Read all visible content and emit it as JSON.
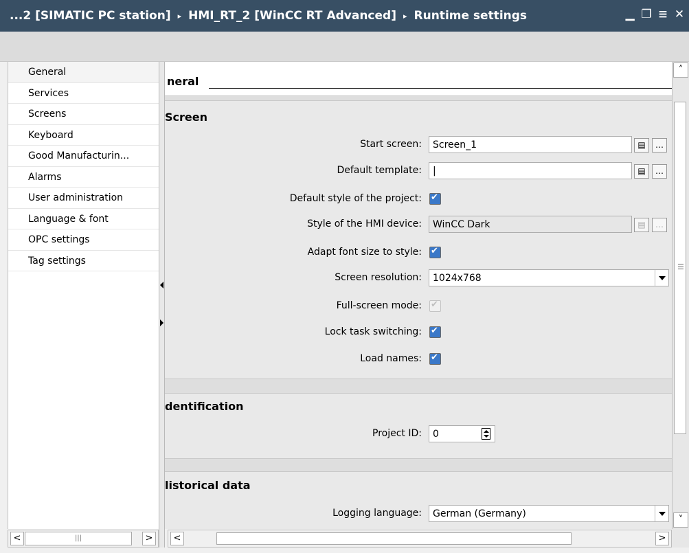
{
  "titlebar": {
    "crumbs": [
      "...2 [SIMATIC PC station]",
      "HMI_RT_2 [WinCC RT Advanced]",
      "Runtime settings"
    ],
    "separator": "▸"
  },
  "nav": {
    "items": [
      "General",
      "Services",
      "Screens",
      "Keyboard",
      "Good Manufacturin...",
      "Alarms",
      "User administration",
      "Language & font",
      "OPC settings",
      "Tag settings"
    ],
    "selected": "General"
  },
  "content": {
    "header": "neral",
    "screen": {
      "title": "Screen",
      "start_screen_label": "Start screen:",
      "start_screen_value": "Screen_1",
      "default_template_label": "Default template:",
      "default_template_value": "|",
      "default_style_label": "Default style of the project:",
      "default_style_checked": true,
      "style_device_label": "Style of the HMI device:",
      "style_device_value": "WinCC Dark",
      "adapt_font_label": "Adapt font size to style:",
      "adapt_font_checked": true,
      "resolution_label": "Screen resolution:",
      "resolution_value": "1024x768",
      "fullscreen_label": "Full-screen mode:",
      "fullscreen_checked": true,
      "lock_task_label": "Lock task switching:",
      "lock_task_checked": true,
      "load_names_label": "Load names:",
      "load_names_checked": true
    },
    "identification": {
      "title": "dentification",
      "project_id_label": "Project ID:",
      "project_id_value": "0"
    },
    "historical": {
      "title": "listorical data",
      "logging_language_label": "Logging language:",
      "logging_language_value": "German (Germany)"
    }
  },
  "icons": [
    "minimize-icon",
    "restore-icon",
    "menu-icon",
    "close-icon",
    "list-icon",
    "ellipsis-icon"
  ]
}
